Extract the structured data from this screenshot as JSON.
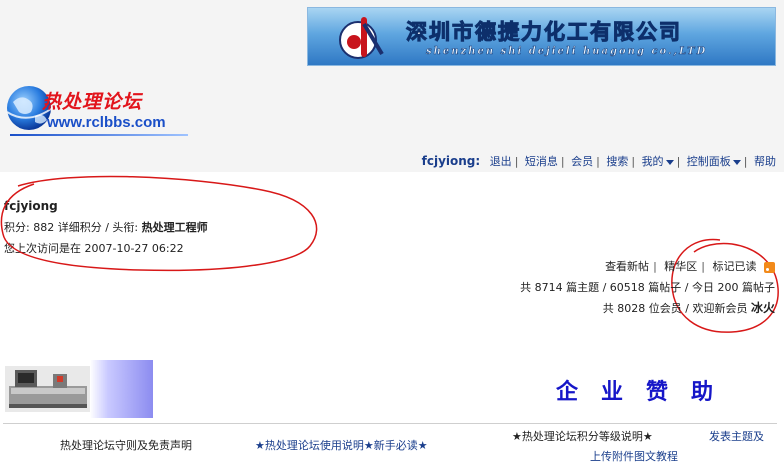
{
  "banner": {
    "title": "深圳市德捷力化工有限公司",
    "subtitle": "shenzhen shi dejieli huagong co.,LTD"
  },
  "site_logo": {
    "name": "热处理论坛",
    "url": "www.rclbbs.com"
  },
  "topnav": {
    "username": "fcjyiong:",
    "items": [
      "退出",
      "短消息",
      "会员",
      "搜索",
      "我的",
      "控制面板",
      "帮助"
    ]
  },
  "user_info": {
    "name": "fcjyiong",
    "points_line": "积分: 882 详细积分 / 头衔: ",
    "title_value": "热处理工程师",
    "last_visit": "您上次访问是在 2007-10-27 06:22"
  },
  "quick_links": [
    "查看新帖",
    "精华区",
    "标记已读"
  ],
  "stats": {
    "line1": "共 8714 篇主题 / 60518 篇帖子 / 今日 200 篇帖子",
    "line2_prefix": "共 8028 位会员 / 欢迎新会员 ",
    "new_member": "冰火"
  },
  "sponsor_title": "企业赞助",
  "footer": {
    "rules": "热处理论坛守则及免责声明",
    "guide": "★热处理论坛使用说明★新手必读★",
    "levels": "★热处理论坛积分等级说明★",
    "post_line1": "发表主题及",
    "post_line2": "上传附件图文教程"
  },
  "colors": {
    "link_blue": "#1a3e8c",
    "sponsor_blue": "#1616c8",
    "logo_red": "#e2141c",
    "annotation_red": "#d81818"
  }
}
